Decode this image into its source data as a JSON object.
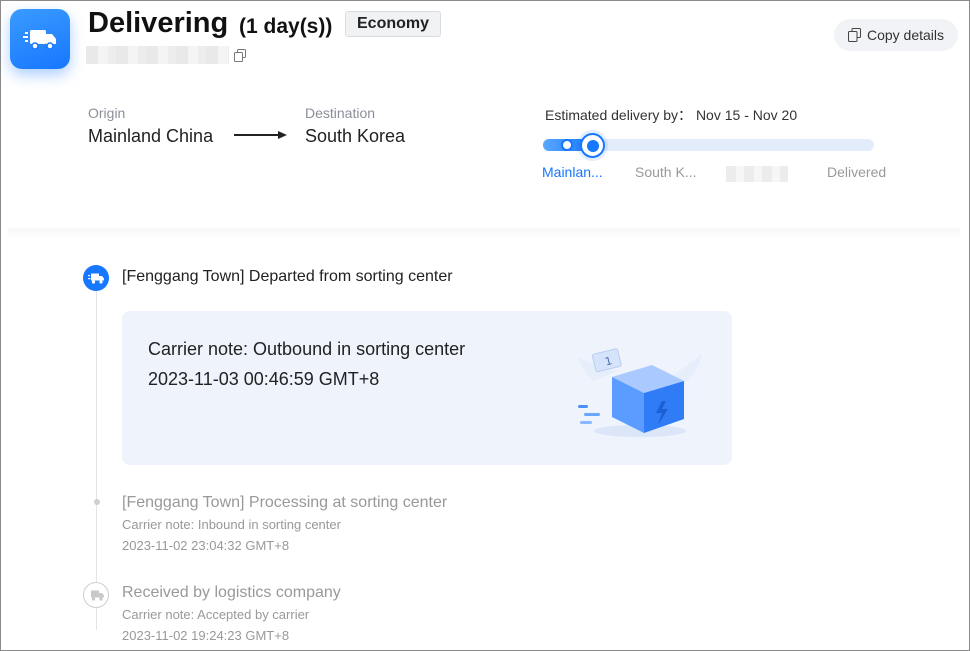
{
  "header": {
    "status_title": "Delivering",
    "duration": "(1 day(s))",
    "service_badge": "Economy",
    "copy_details_label": "Copy details"
  },
  "route": {
    "origin_label": "Origin",
    "origin_value": "Mainland China",
    "destination_label": "Destination",
    "destination_value": "South Korea"
  },
  "progress": {
    "eta_text": "Estimated delivery by： Nov 15 - Nov 20",
    "fraction_complete": 0.15,
    "stages": [
      "Mainlan...",
      "South K...",
      "Delivered"
    ],
    "active_stage_index": 0
  },
  "timeline": {
    "events": [
      {
        "title": "[Fenggang Town] Departed from sorting center",
        "note": "Carrier note: Outbound in sorting center",
        "time": "2023-11-03 00:46:59 GMT+8",
        "icon": "truck-icon",
        "active": true
      },
      {
        "title": "[Fenggang Town] Processing at sorting center",
        "note": "Carrier note: Inbound in sorting center",
        "time": "2023-11-02 23:04:32 GMT+8",
        "icon": "dot-icon",
        "active": false
      },
      {
        "title": "Received by logistics company",
        "note": "Carrier note: Accepted by carrier",
        "time": "2023-11-02 19:24:23 GMT+8",
        "icon": "truck-icon",
        "active": false
      }
    ]
  },
  "colors": {
    "accent": "#1677ff",
    "card_bg": "#eef3fc",
    "muted_text": "#999999"
  }
}
